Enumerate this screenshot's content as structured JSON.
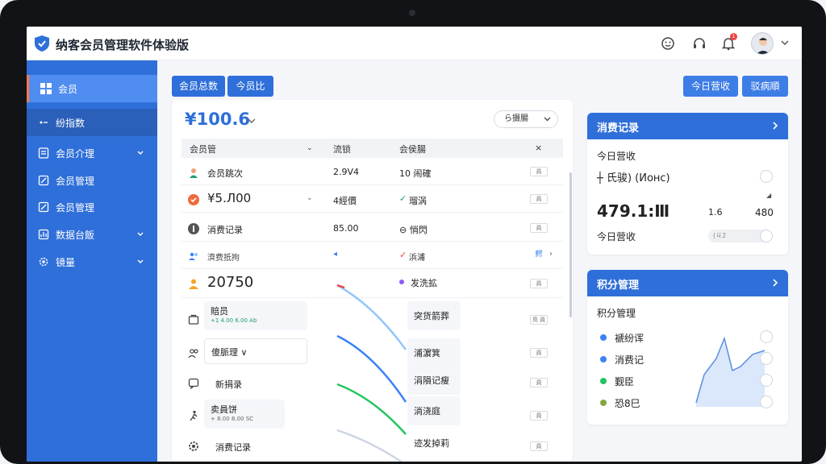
{
  "app": {
    "title": "纳客会员管理软件体验版"
  },
  "header": {
    "notification_count": "1"
  },
  "sidebar": {
    "items": [
      {
        "label": "会员",
        "icon": "grid-icon"
      },
      {
        "label": "纷指数",
        "icon": "dot-icon"
      },
      {
        "label": "会员介理",
        "icon": "file-icon"
      },
      {
        "label": "会员管理",
        "icon": "edit-icon"
      },
      {
        "label": "会员管理",
        "icon": "edit-icon"
      },
      {
        "label": "数据台飯",
        "icon": "chart-icon"
      },
      {
        "label": "镜量",
        "icon": "gear-icon"
      }
    ]
  },
  "toolbar": {
    "tab_total": "会员总数",
    "tab_today": "今员比",
    "btn_revenue": "今日营收",
    "btn_other": "驳病順"
  },
  "main": {
    "amount": "¥100.6",
    "select_label": "ら摄腸",
    "columns": [
      "会员管",
      "流锁",
      "会侯腸",
      "×"
    ],
    "rows": [
      {
        "c1": "会员跳次",
        "c2": "2.9V4",
        "c3": "10 闹確",
        "tag": "員"
      },
      {
        "c1": "¥5.Л00",
        "c2": "4經價",
        "c3": "瑠涡",
        "tag": "員"
      },
      {
        "c1": "消费记录",
        "c2": "85.00",
        "c3": "⊖ 悄閃",
        "tag": "員"
      },
      {
        "c1": "濟费抵拘",
        "c2": "",
        "c3": "浜浦",
        "tag": "鰐"
      },
      {
        "c1": "20750",
        "c2": "",
        "c3": "发洗拡",
        "tag": "員"
      }
    ],
    "cards": [
      {
        "title": "賠员",
        "sub": "+1 4.00 6.00 Ab"
      },
      {
        "title": "傻脈理 ∨",
        "sub": ""
      },
      {
        "title": "新捐录",
        "sub": ""
      },
      {
        "title": "卖員饼",
        "sub": "+ 8.00 8.00 SC"
      },
      {
        "title": "消费记录",
        "sub": ""
      }
    ],
    "right_chips": [
      "突货箭葬",
      "浦濵箕",
      "涓隕记瘦",
      "淌浇庭",
      "迹发掉莉"
    ]
  },
  "consumption": {
    "title": "消费记录",
    "label_today": "今日营收",
    "line_item": "┼ 氏骏) (Ионс)",
    "value_big": "479.1:Ⅲ",
    "value_small_1": "1.6",
    "value_small_2": "480",
    "label_today_2": "今日营收",
    "toggle_text": "(ㄐ2"
  },
  "points": {
    "title": "积分管理",
    "subtitle": "积分管理",
    "items": [
      {
        "label": "褫纷诨",
        "color": "#3b82f6"
      },
      {
        "label": "消费记",
        "color": "#3b82f6"
      },
      {
        "label": "觐臣",
        "color": "#22c55e"
      },
      {
        "label": "恐8巳",
        "color": "#84a83f"
      }
    ]
  }
}
